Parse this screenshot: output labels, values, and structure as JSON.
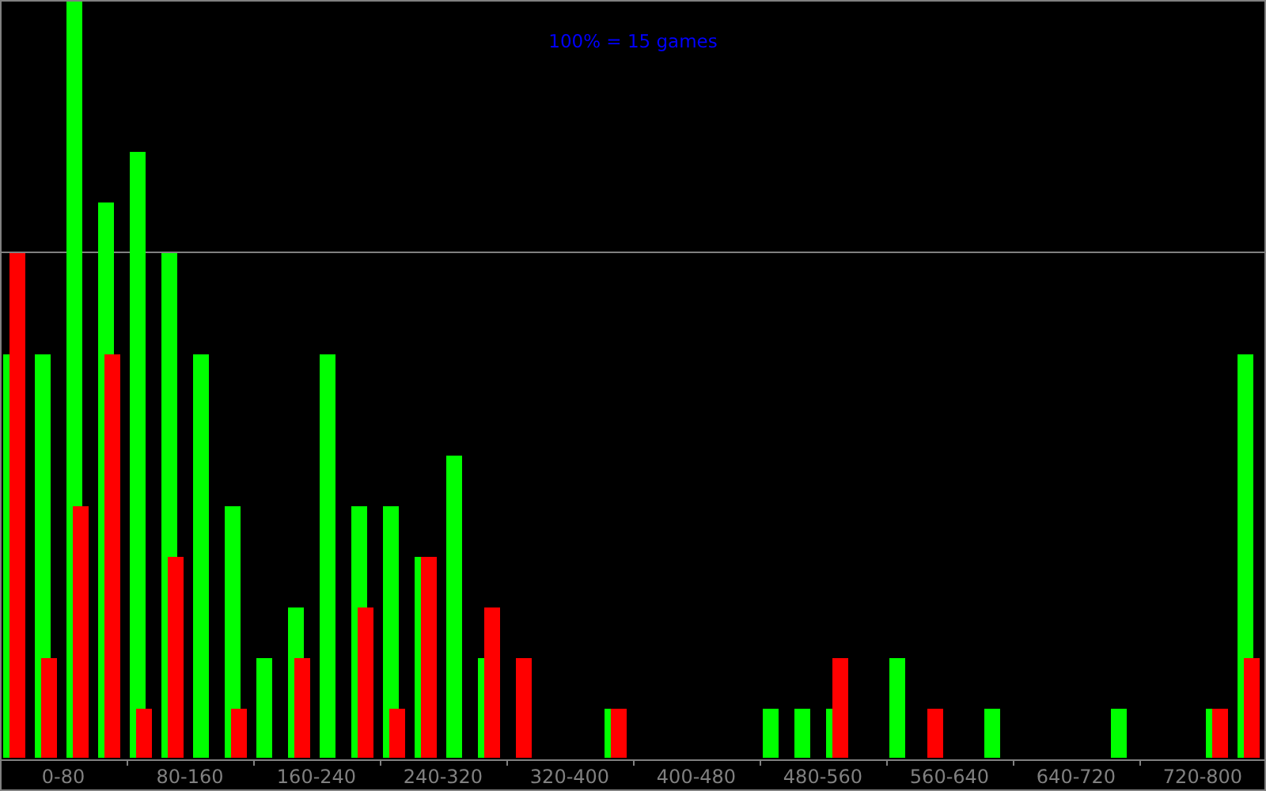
{
  "chart": {
    "caption": "100% = 15 games",
    "axis_labels": [
      "0-80",
      "80-160",
      "160-240",
      "240-320",
      "320-400",
      "400-480",
      "480-560",
      "560-640",
      "640-720",
      "720-800"
    ]
  }
}
